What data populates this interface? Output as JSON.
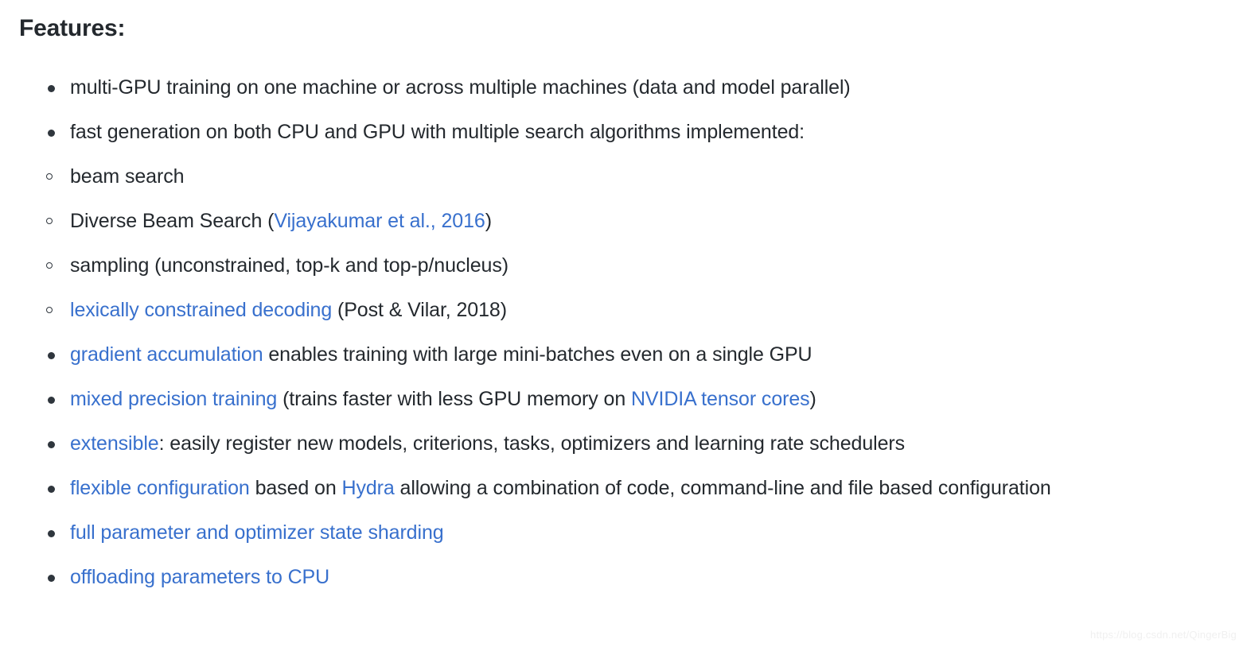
{
  "heading": "Features:",
  "colors": {
    "text": "#24292e",
    "link": "#3870cd",
    "background": "#ffffff",
    "bullet": "#2f363d",
    "watermark": "#f0f0f0"
  },
  "features": [
    {
      "id": "multi-gpu-training",
      "text": "multi-GPU training on one machine or across multiple machines (data and model parallel)"
    },
    {
      "id": "fast-generation",
      "text": "fast generation on both CPU and GPU with multiple search algorithms implemented:",
      "sub_items": [
        {
          "id": "beam-search",
          "parts": [
            {
              "type": "text",
              "value": "beam search"
            }
          ]
        },
        {
          "id": "diverse-beam-search",
          "parts": [
            {
              "type": "text",
              "value": "Diverse Beam Search ("
            },
            {
              "type": "link",
              "value": "Vijayakumar et al., 2016"
            },
            {
              "type": "text",
              "value": ")"
            }
          ]
        },
        {
          "id": "sampling",
          "parts": [
            {
              "type": "text",
              "value": "sampling (unconstrained, top-k and top-p/nucleus)"
            }
          ]
        },
        {
          "id": "lexically-constrained-decoding",
          "parts": [
            {
              "type": "link",
              "value": "lexically constrained decoding"
            },
            {
              "type": "text",
              "value": " (Post & Vilar, 2018)"
            }
          ]
        }
      ]
    },
    {
      "id": "gradient-accumulation",
      "parts": [
        {
          "type": "link",
          "value": "gradient accumulation"
        },
        {
          "type": "text",
          "value": " enables training with large mini-batches even on a single GPU"
        }
      ]
    },
    {
      "id": "mixed-precision-training",
      "parts": [
        {
          "type": "link",
          "value": "mixed precision training"
        },
        {
          "type": "text",
          "value": " (trains faster with less GPU memory on "
        },
        {
          "type": "link",
          "value": "NVIDIA tensor cores"
        },
        {
          "type": "text",
          "value": ")"
        }
      ]
    },
    {
      "id": "extensible",
      "parts": [
        {
          "type": "link",
          "value": "extensible"
        },
        {
          "type": "text",
          "value": ": easily register new models, criterions, tasks, optimizers and learning rate schedulers"
        }
      ]
    },
    {
      "id": "flexible-configuration",
      "parts": [
        {
          "type": "link",
          "value": "flexible configuration"
        },
        {
          "type": "text",
          "value": " based on "
        },
        {
          "type": "link",
          "value": "Hydra"
        },
        {
          "type": "text",
          "value": " allowing a combination of code, command-line and file based configuration"
        }
      ]
    },
    {
      "id": "full-parameter-and-optimizer-state-sharding",
      "parts": [
        {
          "type": "link",
          "value": "full parameter and optimizer state sharding"
        }
      ]
    },
    {
      "id": "offloading-parameters-to-cpu",
      "parts": [
        {
          "type": "link",
          "value": "offloading parameters to CPU"
        }
      ]
    }
  ],
  "watermark": "https://blog.csdn.net/QingerBig"
}
